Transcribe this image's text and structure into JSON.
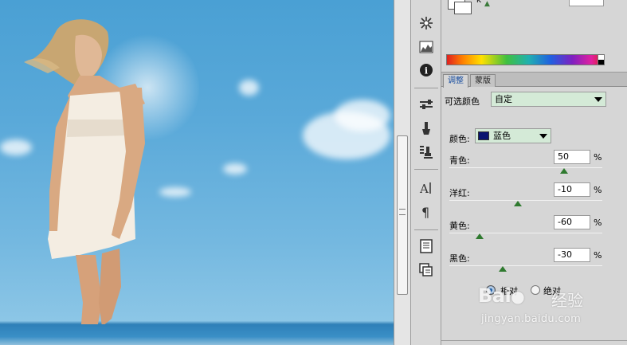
{
  "canvas": {
    "description_icons": [
      "sky-photo"
    ]
  },
  "dock": {
    "icons": [
      "asterisk-brush-icon",
      "histogram-icon",
      "info-icon",
      "sliders-icon",
      "paintbrush-icon",
      "clone-stamp-icon",
      "character-icon",
      "paragraph-icon",
      "notes-icon",
      "layer-comps-icon"
    ]
  },
  "color_panel": {
    "k_label": "K"
  },
  "adjust_panel": {
    "tabs": [
      {
        "label": "调整",
        "active": true
      },
      {
        "label": "蒙版",
        "active": false
      }
    ],
    "preset": {
      "label": "可选颜色",
      "value": "自定"
    },
    "colors": {
      "label": "颜色:",
      "value": "蓝色",
      "chip_color": "#0a1470"
    },
    "sliders": [
      {
        "label": "青色:",
        "value": "50",
        "unit": "%",
        "level": 0.75
      },
      {
        "label": "洋红:",
        "value": "-10",
        "unit": "%",
        "level": 0.45
      },
      {
        "label": "黄色:",
        "value": "-60",
        "unit": "%",
        "level": 0.2
      },
      {
        "label": "黑色:",
        "value": "-30",
        "unit": "%",
        "level": 0.35
      }
    ],
    "mode": {
      "relative": "相对",
      "absolute": "绝对",
      "selected": "relative"
    }
  },
  "watermark": {
    "brand": "Bai",
    "brand_suffix": "经验",
    "url": "jingyan.baidu.com"
  },
  "colors": {
    "accent_green": "#d4ead7",
    "slider_thumb": "#2f7a2f",
    "tab_active_text": "#1a4fa0"
  }
}
